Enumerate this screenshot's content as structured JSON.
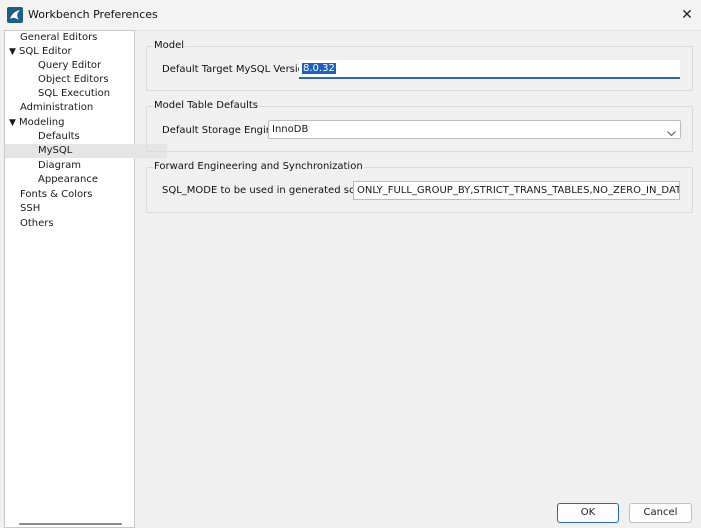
{
  "window": {
    "title": "Workbench Preferences"
  },
  "sidebar": {
    "items": [
      {
        "label": "General Editors",
        "level": 0,
        "expanded": null
      },
      {
        "label": "SQL Editor",
        "level": 0,
        "expanded": true
      },
      {
        "label": "Query Editor",
        "level": 1,
        "expanded": null
      },
      {
        "label": "Object Editors",
        "level": 1,
        "expanded": null
      },
      {
        "label": "SQL Execution",
        "level": 1,
        "expanded": null
      },
      {
        "label": "Administration",
        "level": 0,
        "expanded": null
      },
      {
        "label": "Modeling",
        "level": 0,
        "expanded": true
      },
      {
        "label": "Defaults",
        "level": 1,
        "expanded": null
      },
      {
        "label": "MySQL",
        "level": 1,
        "expanded": null,
        "selected": true
      },
      {
        "label": "Diagram",
        "level": 1,
        "expanded": null
      },
      {
        "label": "Appearance",
        "level": 1,
        "expanded": null
      },
      {
        "label": "Fonts & Colors",
        "level": 0,
        "expanded": null
      },
      {
        "label": "SSH",
        "level": 0,
        "expanded": null
      },
      {
        "label": "Others",
        "level": 0,
        "expanded": null
      }
    ]
  },
  "model": {
    "title": "Model",
    "version_label": "Default Target MySQL Version:",
    "version_value": "8.0.32"
  },
  "table_defaults": {
    "title": "Model Table Defaults",
    "engine_label": "Default Storage Engine:",
    "engine_value": "InnoDB"
  },
  "forward": {
    "title": "Forward Engineering and Synchronization",
    "sqlmode_label": "SQL_MODE to be used in generated scripts:",
    "sqlmode_value": "ONLY_FULL_GROUP_BY,STRICT_TRANS_TABLES,NO_ZERO_IN_DATE,NO_"
  },
  "buttons": {
    "ok": "OK",
    "cancel": "Cancel"
  },
  "colors": {
    "accent": "#1b5fc7",
    "selection_bg": "#e5e5e5"
  }
}
